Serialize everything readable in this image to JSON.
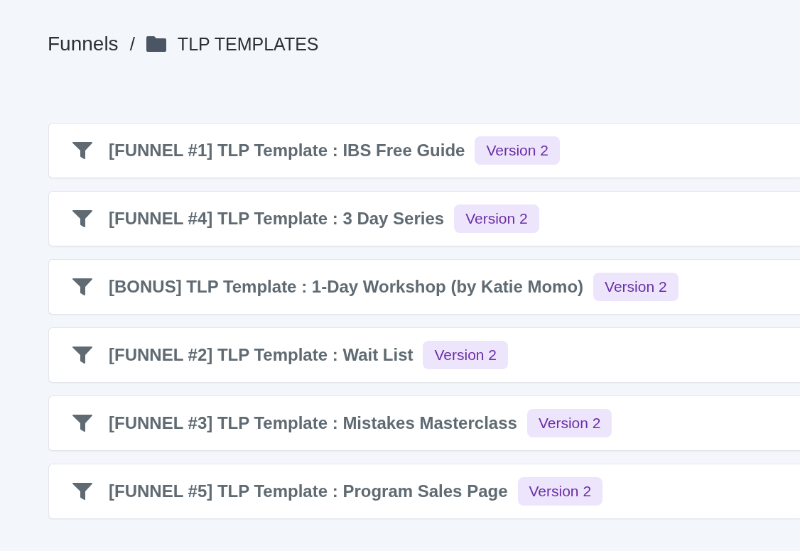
{
  "breadcrumb": {
    "root": "Funnels",
    "separator": "/",
    "folder": "TLP TEMPLATES"
  },
  "funnels": [
    {
      "name": "[FUNNEL #1] TLP Template : IBS Free Guide",
      "badge": "Version 2"
    },
    {
      "name": "[FUNNEL #4] TLP Template : 3 Day Series",
      "badge": "Version 2"
    },
    {
      "name": "[BONUS] TLP Template : 1-Day Workshop (by Katie Momo)",
      "badge": "Version 2"
    },
    {
      "name": "[FUNNEL #2] TLP Template : Wait List",
      "badge": "Version 2"
    },
    {
      "name": "[FUNNEL #3] TLP Template : Mistakes Masterclass",
      "badge": "Version 2"
    },
    {
      "name": "[FUNNEL #5] TLP Template : Program Sales Page",
      "badge": "Version 2"
    }
  ]
}
